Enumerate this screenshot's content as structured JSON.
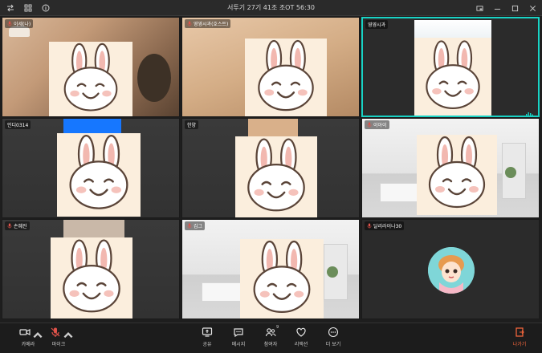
{
  "window": {
    "title": "서투기 27기 41조 조OT 56:30"
  },
  "tiles": [
    {
      "name": "이세(나)"
    },
    {
      "name": "영영시과(호스트)"
    },
    {
      "name": "영영시과"
    },
    {
      "name": "인디0314"
    },
    {
      "name": "한양"
    },
    {
      "name": "이아이"
    },
    {
      "name": "손혜진"
    },
    {
      "name": "김그"
    },
    {
      "name": "달리라이나30"
    }
  ],
  "toolbar": {
    "camera_label": "카메라",
    "mic_label": "마이크",
    "share_label": "공유",
    "message_label": "메시지",
    "participants_label": "참여자",
    "participants_count": "9",
    "reactions_label": "리액션",
    "more_label": "더 보기",
    "exit_label": "나가기"
  },
  "colors": {
    "speaking_border": "#19d3c5",
    "exit": "#ff6a3d",
    "muted_mic": "#e0524a"
  },
  "icons": {
    "title_left": [
      "swap-icon",
      "grid-icon",
      "info-icon"
    ],
    "window_controls": [
      "pip-icon",
      "minimize-icon",
      "maximize-icon",
      "close-icon"
    ]
  }
}
